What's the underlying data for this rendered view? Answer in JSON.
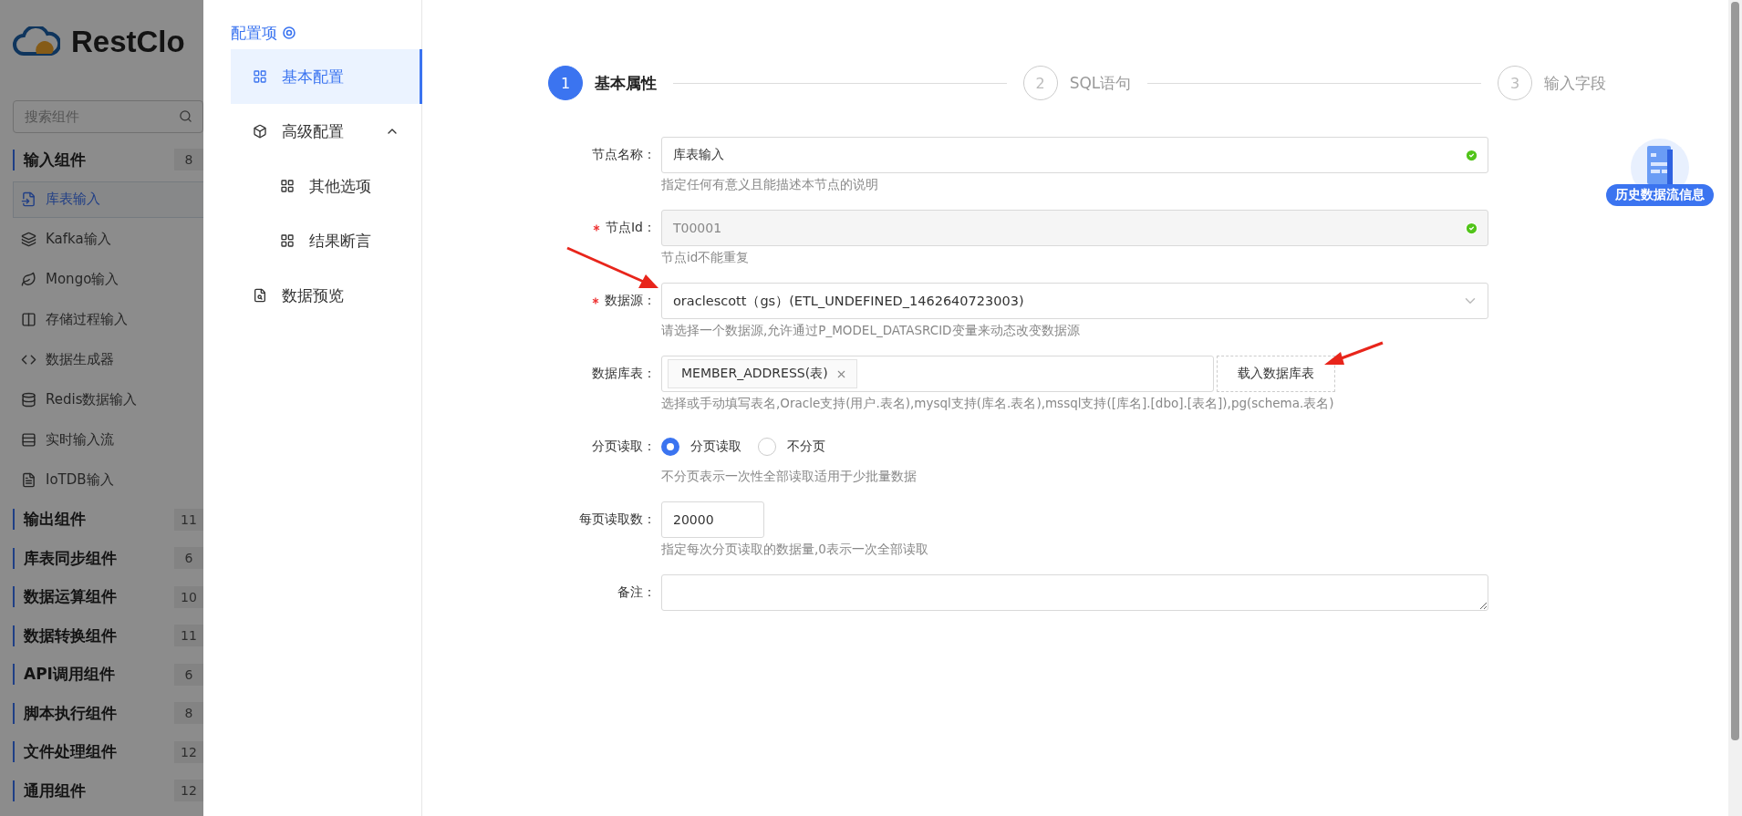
{
  "sidebar": {
    "logo_text": "RestClo",
    "search": {
      "placeholder": "搜索组件"
    },
    "groups": [
      {
        "label": "输入组件",
        "count": "8",
        "items": [
          {
            "label": "库表输入",
            "selected": true
          },
          {
            "label": "Kafka输入",
            "selected": false
          },
          {
            "label": "Mongo输入",
            "selected": false
          },
          {
            "label": "存储过程输入",
            "selected": false
          },
          {
            "label": "数据生成器",
            "selected": false
          },
          {
            "label": "Redis数据输入",
            "selected": false
          },
          {
            "label": "实时输入流",
            "selected": false
          },
          {
            "label": "IoTDB输入",
            "selected": false
          }
        ]
      },
      {
        "label": "输出组件",
        "count": "11"
      },
      {
        "label": "库表同步组件",
        "count": "6"
      },
      {
        "label": "数据运算组件",
        "count": "10"
      },
      {
        "label": "数据转换组件",
        "count": "11"
      },
      {
        "label": "API调用组件",
        "count": "6"
      },
      {
        "label": "脚本执行组件",
        "count": "8"
      },
      {
        "label": "文件处理组件",
        "count": "12"
      },
      {
        "label": "通用组件",
        "count": "12"
      }
    ]
  },
  "config_nav": {
    "title": "配置项",
    "items": [
      {
        "label": "基本配置",
        "kind": "grid",
        "selected": true
      },
      {
        "label": "高级配置",
        "kind": "cube",
        "selected": false,
        "expanded": true,
        "children": [
          {
            "label": "其他选项",
            "kind": "grid",
            "selected": false
          },
          {
            "label": "结果断言",
            "kind": "grid",
            "selected": false
          }
        ]
      },
      {
        "label": "数据预览",
        "kind": "preview",
        "selected": false
      }
    ]
  },
  "steps": [
    {
      "number": "1",
      "label": "基本属性",
      "selected": true
    },
    {
      "number": "2",
      "label": "SQL语句",
      "selected": false
    },
    {
      "number": "3",
      "label": "输入字段",
      "selected": false
    }
  ],
  "form": [
    {
      "kind": "text",
      "label": "节点名称：",
      "required": false,
      "value": "库表输入",
      "valid": true,
      "disabled": false,
      "help": "指定任何有意义且能描述本节点的说明"
    },
    {
      "kind": "text",
      "label": "节点Id：",
      "required": true,
      "value": "T00001",
      "valid": true,
      "disabled": true,
      "help": "节点id不能重复"
    },
    {
      "kind": "select",
      "label": "数据源：",
      "required": true,
      "value": "oraclescott（gs）(ETL_UNDEFINED_1462640723003)",
      "help": "请选择一个数据源,允许通过P_MODEL_DATASRCID变量来动态改变数据源"
    },
    {
      "kind": "tags",
      "label": "数据库表：",
      "required": false,
      "tags": [
        "MEMBER_ADDRESS(表)"
      ],
      "button": "载入数据库表",
      "help": "选择或手动填写表名,Oracle支持(用户.表名),mysql支持(库名.表名),mssql支持([库名].[dbo].[表名]),pg(schema.表名)"
    },
    {
      "kind": "radio",
      "label": "分页读取：",
      "required": false,
      "options": [
        {
          "label": "分页读取",
          "selected": true
        },
        {
          "label": "不分页",
          "selected": false
        }
      ],
      "help": "不分页表示一次性全部读取适用于少批量数据"
    },
    {
      "kind": "number",
      "label": "每页读取数：",
      "required": false,
      "value": "20000",
      "help": "指定每次分页读取的数据量,0表示一次全部读取"
    },
    {
      "kind": "textarea",
      "label": "备注：",
      "required": false
    }
  ],
  "history_badge": {
    "label": "历史数据流信息"
  }
}
